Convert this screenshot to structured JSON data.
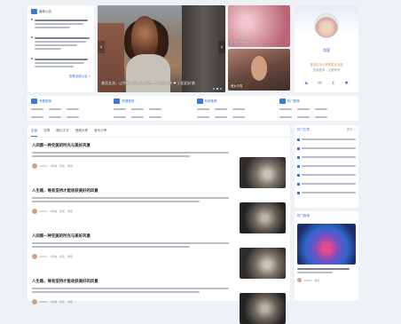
{
  "notice": {
    "title": "最新公告",
    "more": "查看全部公告 »"
  },
  "carousel": {
    "caption": "美丽女孩，让你的心灵从此绽放——漂亮女孩 ❤ 小姐姐好美"
  },
  "thumbs": [
    {
      "caption": "粉色花海美景"
    },
    {
      "caption": "美女写真"
    }
  ],
  "user": {
    "name": "游客",
    "desc": "登录后可以享受更多功能",
    "desc2": "快速登录 · 注册账号"
  },
  "quick": [
    {
      "title": "专题推荐"
    },
    {
      "title": "资源推荐"
    },
    {
      "title": "系统推荐"
    },
    {
      "title": "热门推荐"
    }
  ],
  "tabs": [
    "全部",
    "文章",
    "图片文字",
    "视频分享",
    "音乐分享"
  ],
  "articles": [
    {
      "title": "人间第一种完美的时光与美好风景",
      "meta": "admin · 1年前 · 评论 · 浏览"
    },
    {
      "title": "人生路，唯有坚持才能收获美好的风景",
      "meta": "admin · 1年前 · 评论 · 浏览"
    },
    {
      "title": "人间第一种完美的时光与美好风景",
      "meta": "admin · 1年前 · 评论 · 浏览"
    },
    {
      "title": "人生路，唯有坚持才能收获美好的风景",
      "meta": "admin · 1年前 · 评论 · 浏览"
    }
  ],
  "side1": {
    "title": "热门文章",
    "more": "更多 »"
  },
  "side2": {
    "title": "热门推荐",
    "meta": "admin · 浏览"
  },
  "colors": {
    "accent": "#3a78d6",
    "bg": "#eef1f6"
  }
}
